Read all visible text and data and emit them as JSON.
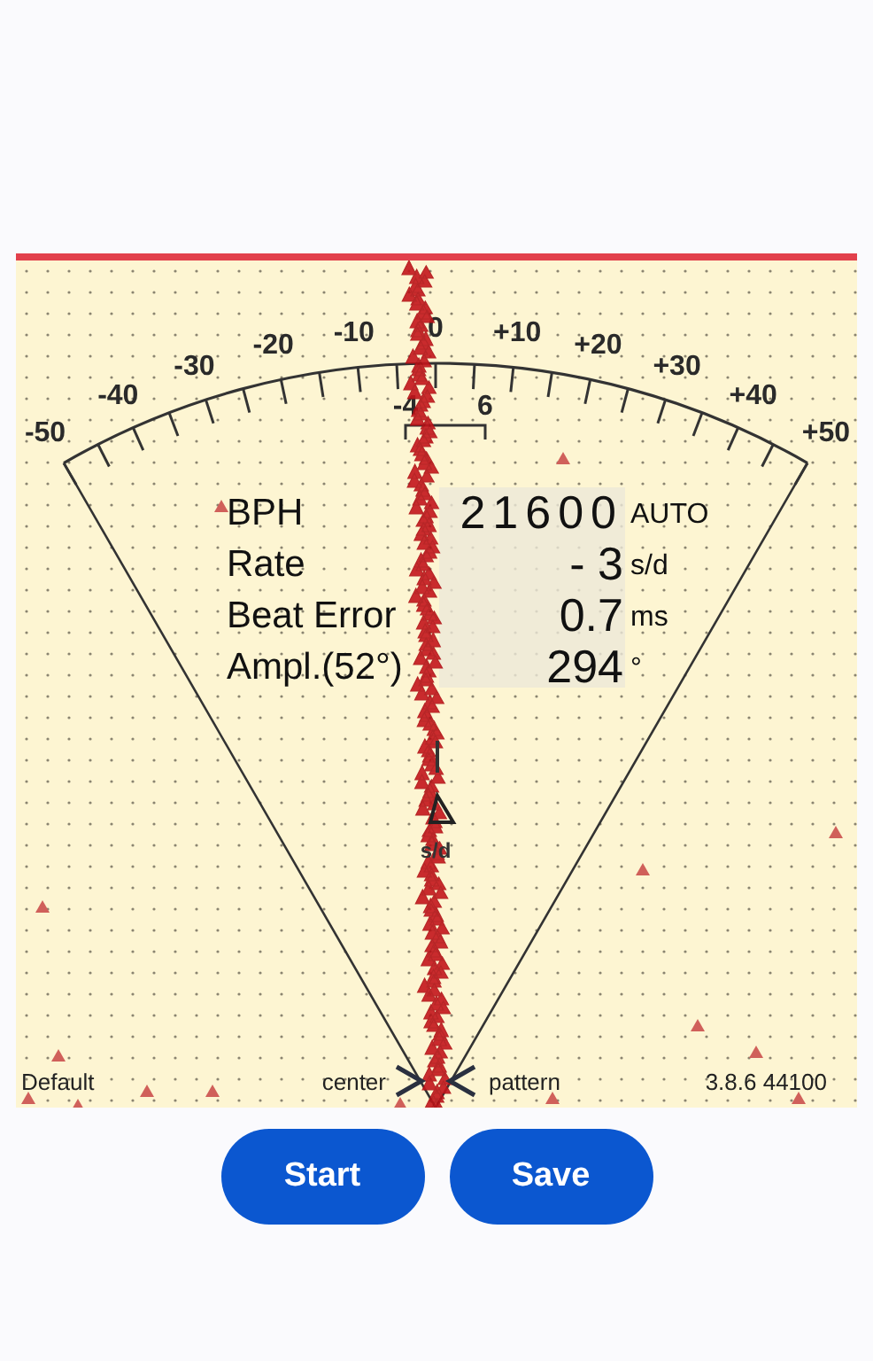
{
  "scale": {
    "labels": [
      "-50",
      "-40",
      "-30",
      "-20",
      "-10",
      "0",
      "+10",
      "+20",
      "+30",
      "+40",
      "+50"
    ],
    "sub_labels": [
      "-4",
      "6"
    ]
  },
  "readouts": [
    {
      "label": "BPH",
      "value": "21600",
      "unit": "AUTO"
    },
    {
      "label": "Rate",
      "value": "- 3",
      "unit": "s/d"
    },
    {
      "label": "Beat Error",
      "value": "0.7",
      "unit": "ms"
    },
    {
      "label": "Ampl.(52°)",
      "value": "294",
      "unit": "°"
    }
  ],
  "pointer_label": "s/d",
  "footer": {
    "profile": "Default",
    "center": "center",
    "pattern": "pattern",
    "version": "3.8.6 44100"
  },
  "buttons": [
    "Start",
    "Save"
  ]
}
